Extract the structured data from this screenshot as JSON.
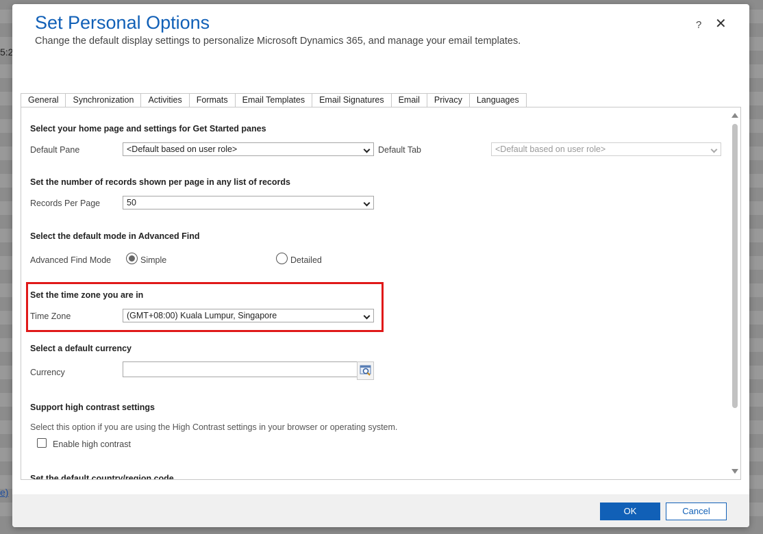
{
  "background": {
    "fragment_top": "5:2",
    "fragment_bottom": "e)"
  },
  "dialog": {
    "title": "Set Personal Options",
    "subtitle": "Change the default display settings to personalize Microsoft Dynamics 365, and manage your email templates.",
    "help_label": "?",
    "close_label": "✕"
  },
  "tabs": [
    {
      "label": "General",
      "active": true
    },
    {
      "label": "Synchronization"
    },
    {
      "label": "Activities"
    },
    {
      "label": "Formats"
    },
    {
      "label": "Email Templates"
    },
    {
      "label": "Email Signatures"
    },
    {
      "label": "Email"
    },
    {
      "label": "Privacy"
    },
    {
      "label": "Languages"
    }
  ],
  "general": {
    "home": {
      "heading": "Select your home page and settings for Get Started panes",
      "default_pane_label": "Default Pane",
      "default_pane_value": "<Default based on user role>",
      "default_tab_label": "Default Tab",
      "default_tab_value": "<Default based on user role>"
    },
    "records": {
      "heading": "Set the number of records shown per page in any list of records",
      "label": "Records Per Page",
      "value": "50"
    },
    "advanced_find": {
      "heading": "Select the default mode in Advanced Find",
      "label": "Advanced Find Mode",
      "option_simple": "Simple",
      "option_detailed": "Detailed",
      "selected": "Simple"
    },
    "timezone": {
      "heading": "Set the time zone you are in",
      "label": "Time Zone",
      "value": "(GMT+08:00) Kuala Lumpur, Singapore"
    },
    "currency": {
      "heading": "Select a default currency",
      "label": "Currency",
      "value": ""
    },
    "contrast": {
      "heading": "Support high contrast settings",
      "description": "Select this option if you are using the High Contrast settings in your browser or operating system.",
      "checkbox_label": "Enable high contrast",
      "checked": false
    },
    "country": {
      "heading": "Set the default country/region code"
    }
  },
  "footer": {
    "ok_label": "OK",
    "cancel_label": "Cancel"
  },
  "colors": {
    "accent": "#1160b7",
    "highlight": "#e01919"
  }
}
